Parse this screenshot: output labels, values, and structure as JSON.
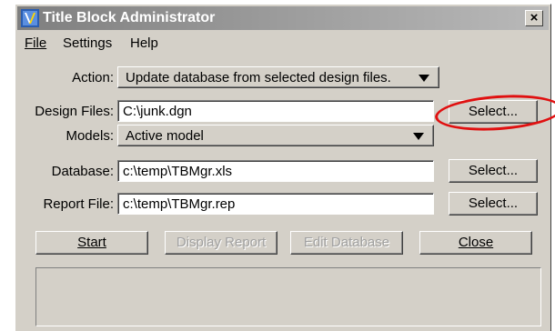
{
  "window": {
    "title": "Title Block Administrator",
    "close_glyph": "×"
  },
  "menu": {
    "file": "File",
    "settings": "Settings",
    "help": "Help"
  },
  "form": {
    "action_label": "Action:",
    "action_value": "Update database from selected design files.",
    "design_files_label": "Design Files:",
    "design_files_value": "C:\\junk.dgn",
    "models_label": "Models:",
    "models_value": "Active model",
    "database_label": "Database:",
    "database_value": "c:\\temp\\TBMgr.xls",
    "report_file_label": "Report File:",
    "report_file_value": "c:\\temp\\TBMgr.rep",
    "select_label": "Select..."
  },
  "buttons": {
    "start": "Start",
    "display_report": "Display Report",
    "edit_database": "Edit Database",
    "close": "Close"
  },
  "status_text": "",
  "colors": {
    "dialog_bg": "#d4d0c8",
    "title_gradient_start": "#7f7f7f",
    "title_gradient_end": "#b9b9b9",
    "highlight_ellipse": "#e01010"
  },
  "icons": {
    "app": "title-block-app-icon",
    "dropdown": "triangle-down-icon"
  }
}
